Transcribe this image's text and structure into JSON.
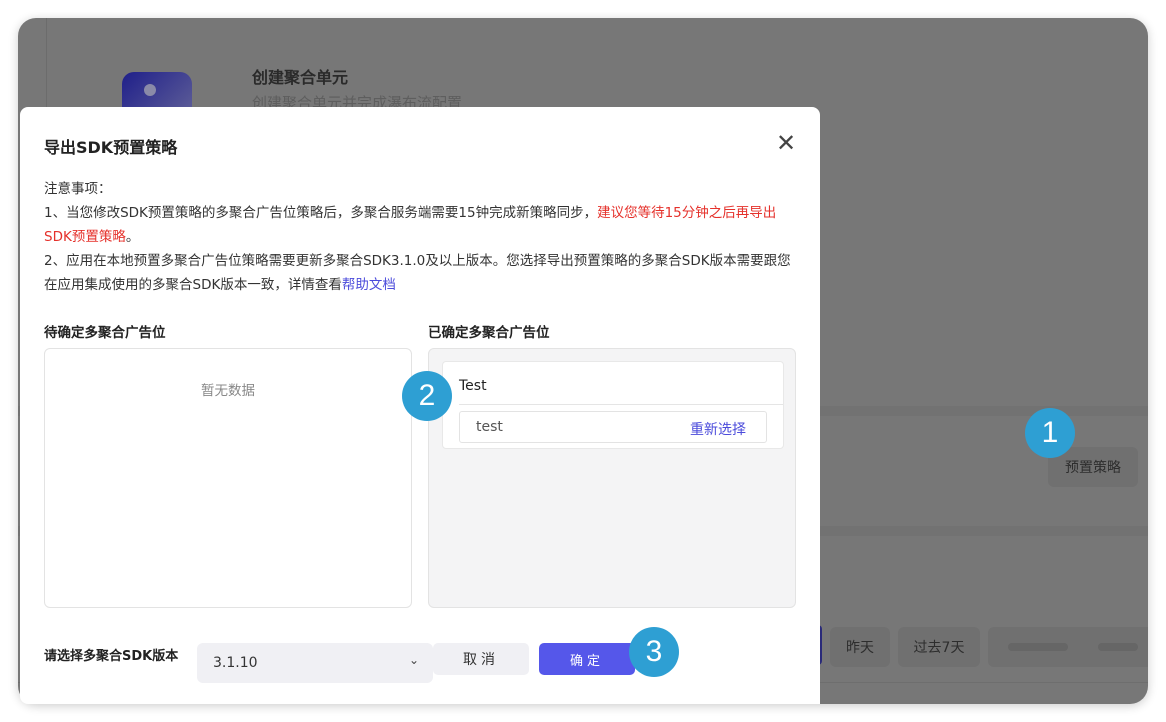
{
  "background": {
    "card_title": "创建聚合单元",
    "card_subtitle": "创建聚合单元并完成瀑布流配置",
    "preset_button": "预置策略",
    "date_buttons": [
      "昨天",
      "过去7天"
    ]
  },
  "dialog": {
    "title": "导出SDK预置策略",
    "notes_heading": "注意事项：",
    "note1_prefix": "1、当您修改SDK预置策略的多聚合广告位策略后，多聚合服务端需要15钟完成新策略同步，",
    "note1_warning": "建议您等待15分钟之后再导出SDK预置策略",
    "note1_suffix": "。",
    "note2_prefix": "2、应用在本地预置多聚合广告位策略需要更新多聚合SDK3.1.0及以上版本。您选择导出预置策略的多聚合SDK版本需要跟您在应用集成使用的多聚合SDK版本一致，详情查看",
    "note2_link": "帮助文档",
    "pending_title": "待确定多聚合广告位",
    "pending_empty": "暂无数据",
    "confirmed_title": "已确定多聚合广告位",
    "confirmed_group": "Test",
    "confirmed_item": "test",
    "reselect_link": "重新选择",
    "version_label": "请选择多聚合SDK版本",
    "version_value": "3.1.10",
    "cancel_button": "取消",
    "confirm_button": "确定"
  },
  "badges": [
    "1",
    "2",
    "3"
  ],
  "colors": {
    "accent": "#5557ea",
    "badge": "#2e9fd3",
    "warning": "#e5312b",
    "link": "#4b4bdb"
  }
}
